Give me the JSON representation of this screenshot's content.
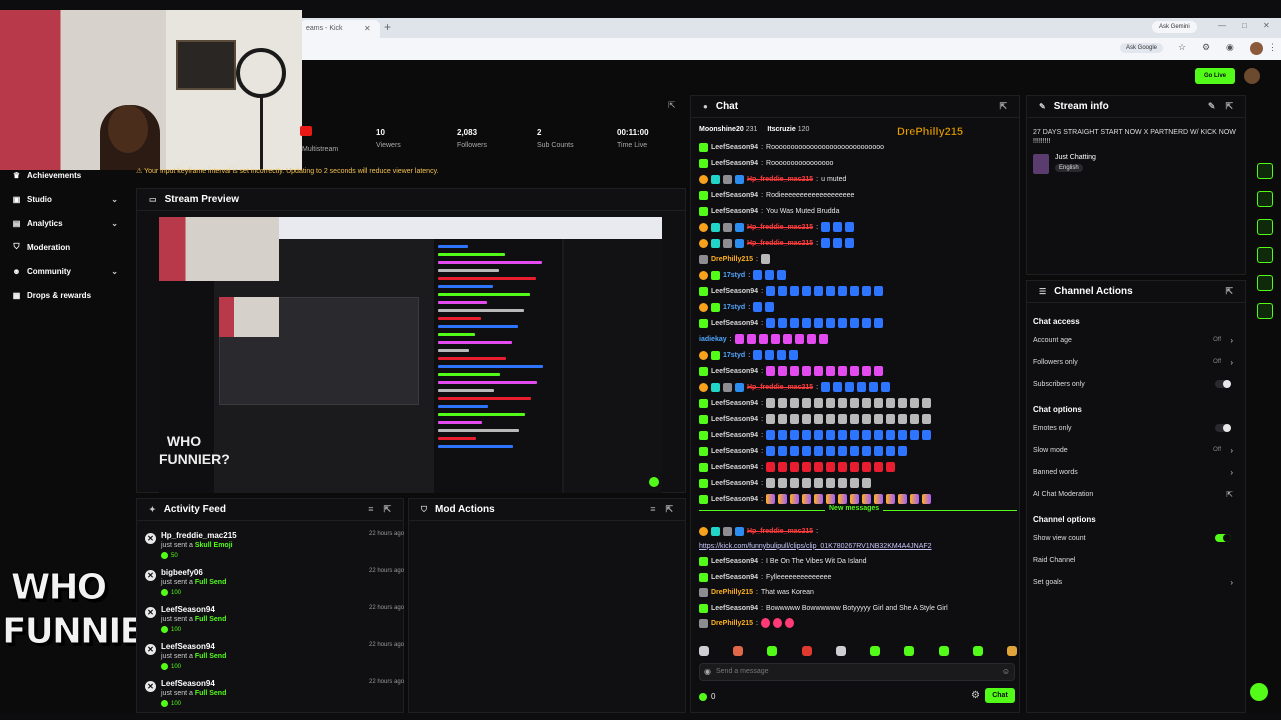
{
  "browser": {
    "tab_title": "eams - Kick",
    "ask_gemini": "Ask Gemini",
    "ask_google": "Ask Google"
  },
  "app": {
    "go_live": "Go Live"
  },
  "nav": {
    "items": [
      {
        "label": "Achievements",
        "icon": "trophy-icon",
        "chevron": false
      },
      {
        "label": "Studio",
        "icon": "video-icon",
        "chevron": true
      },
      {
        "label": "Analytics",
        "icon": "chart-icon",
        "chevron": true
      },
      {
        "label": "Moderation",
        "icon": "shield-icon",
        "chevron": false
      },
      {
        "label": "Community",
        "icon": "users-icon",
        "chevron": true
      },
      {
        "label": "Drops & rewards",
        "icon": "gift-icon",
        "chevron": false
      }
    ]
  },
  "logo_text": "WHO FUNNIER?",
  "stats": {
    "multistream_label": "Multistream",
    "viewers": {
      "value": "10",
      "label": "Viewers"
    },
    "followers": {
      "value": "2,083",
      "label": "Followers"
    },
    "subs": {
      "value": "2",
      "label": "Sub Counts"
    },
    "time": {
      "value": "00:11:00",
      "label": "Time Live"
    }
  },
  "alert_text": "Your input keyframe interval is set incorrectly. Updating to 2 seconds will reduce viewer latency.",
  "preview": {
    "title": "Stream Preview",
    "overlay_text": "WHO FUNNIER?"
  },
  "activity": {
    "title": "Activity Feed",
    "items": [
      {
        "name": "Hp_freddie_mac215",
        "action": "just sent a ",
        "item": "Skull Emoji",
        "time": "22 hours ago",
        "amount": "50"
      },
      {
        "name": "bigbeefy06",
        "action": "just sent a ",
        "item": "Full Send",
        "time": "22 hours ago",
        "amount": "100"
      },
      {
        "name": "LeefSeason94",
        "action": "just sent a ",
        "item": "Full Send",
        "time": "22 hours ago",
        "amount": "100"
      },
      {
        "name": "LeefSeason94",
        "action": "just sent a ",
        "item": "Full Send",
        "time": "22 hours ago",
        "amount": "100"
      },
      {
        "name": "LeefSeason94",
        "action": "just sent a ",
        "item": "Full Send",
        "time": "22 hours ago",
        "amount": "100"
      }
    ]
  },
  "mod_actions": {
    "title": "Mod Actions"
  },
  "chat": {
    "title": "Chat",
    "pinned": [
      {
        "name": "Moonshine20",
        "value": "231"
      },
      {
        "name": "Itscruzie",
        "value": "120"
      }
    ],
    "overlay_name": "DrePhilly215",
    "new_messages_label": "New messages",
    "input_placeholder": "Send a message",
    "viewer_count": "0",
    "send_label": "Chat",
    "messages": [
      {
        "user": "LeefSeason94",
        "ucls": "u-green",
        "badges": [
          "b-green"
        ],
        "text": "Rooooooooooooooooooooooooooooo"
      },
      {
        "user": "LeefSeason94",
        "ucls": "u-green",
        "badges": [
          "b-green"
        ],
        "text": "Roooooooooooooooo"
      },
      {
        "user": "Hp_freddie_mac215",
        "ucls": "u-red",
        "badges": [
          "b-orange",
          "b-teal",
          "b-gray",
          "b-blue"
        ],
        "text": "u muted"
      },
      {
        "user": "LeefSeason94",
        "ucls": "u-green",
        "badges": [
          "b-green"
        ],
        "text": "Rodieeeeeeeeeeeeeeeeeee"
      },
      {
        "user": "LeefSeason94",
        "ucls": "u-green",
        "badges": [
          "b-green"
        ],
        "text": "You Was Muted Brudda"
      },
      {
        "user": "Hp_freddie_mac215",
        "ucls": "u-red",
        "badges": [
          "b-orange",
          "b-teal",
          "b-gray",
          "b-blue"
        ],
        "text": "",
        "emotes": 3,
        "ecls": "e-blue"
      },
      {
        "user": "Hp_freddie_mac215",
        "ucls": "u-red",
        "badges": [
          "b-orange",
          "b-teal",
          "b-gray",
          "b-blue"
        ],
        "text": "",
        "emotes": 3,
        "ecls": "e-blue"
      },
      {
        "user": "DrePhilly215",
        "ucls": "u-orange",
        "badges": [
          "b-gray"
        ],
        "text": "",
        "emotes": 1,
        "ecls": "e-gray"
      },
      {
        "user": "17styd",
        "ucls": "u-cyan",
        "badges": [
          "b-orange",
          "b-green"
        ],
        "text": "",
        "emotes": 3,
        "ecls": "e-blue"
      },
      {
        "user": "LeefSeason94",
        "ucls": "u-green",
        "badges": [
          "b-green"
        ],
        "text": "",
        "emotes": 10,
        "ecls": "e-blue"
      },
      {
        "user": "17styd",
        "ucls": "u-cyan",
        "badges": [
          "b-orange",
          "b-green"
        ],
        "text": "",
        "emotes": 2,
        "ecls": "e-blue"
      },
      {
        "user": "LeefSeason94",
        "ucls": "u-green",
        "badges": [
          "b-green"
        ],
        "text": "",
        "emotes": 10,
        "ecls": "e-blue"
      },
      {
        "user": "iadiekay",
        "ucls": "u-cyan",
        "badges": [],
        "text": "",
        "emotes": 8,
        "ecls": "e-pink"
      },
      {
        "user": "17styd",
        "ucls": "u-cyan",
        "badges": [
          "b-orange",
          "b-green"
        ],
        "text": "",
        "emotes": 4,
        "ecls": "e-blue"
      },
      {
        "user": "LeefSeason94",
        "ucls": "u-green",
        "badges": [
          "b-green"
        ],
        "text": "",
        "emotes": 10,
        "ecls": "e-pink"
      },
      {
        "user": "Hp_freddie_mac215",
        "ucls": "u-red",
        "badges": [
          "b-orange",
          "b-teal",
          "b-gray",
          "b-blue"
        ],
        "text": "",
        "emotes": 6,
        "ecls": "e-blue"
      },
      {
        "user": "LeefSeason94",
        "ucls": "u-green",
        "badges": [
          "b-green"
        ],
        "text": "",
        "emotes": 14,
        "ecls": "e-gray"
      },
      {
        "user": "LeefSeason94",
        "ucls": "u-green",
        "badges": [
          "b-green"
        ],
        "text": "",
        "emotes": 14,
        "ecls": "e-gray"
      },
      {
        "user": "LeefSeason94",
        "ucls": "u-green",
        "badges": [
          "b-green"
        ],
        "text": "",
        "emotes": 14,
        "ecls": "e-blue"
      },
      {
        "user": "LeefSeason94",
        "ucls": "u-green",
        "badges": [
          "b-green"
        ],
        "text": "",
        "emotes": 12,
        "ecls": "e-blue"
      },
      {
        "user": "LeefSeason94",
        "ucls": "u-green",
        "badges": [
          "b-green"
        ],
        "text": "",
        "emotes": 11,
        "ecls": "e-red"
      },
      {
        "user": "LeefSeason94",
        "ucls": "u-green",
        "badges": [
          "b-green"
        ],
        "text": "",
        "emotes": 9,
        "ecls": "e-gray"
      },
      {
        "user": "LeefSeason94",
        "ucls": "u-green",
        "badges": [
          "b-green"
        ],
        "text": "",
        "emotes": 14,
        "ecls": "e-mix"
      },
      {
        "user": "Hp_freddie_mac215",
        "ucls": "u-red",
        "badges": [
          "b-orange",
          "b-teal",
          "b-gray",
          "b-blue"
        ],
        "text": ""
      },
      {
        "user": "",
        "ucls": "u-green",
        "badges": [],
        "text": "https://kick.com/funnybulipull/clips/clip_01K780267RV1NB32KM4A4JNAF2",
        "link": true
      },
      {
        "user": "LeefSeason94",
        "ucls": "u-green",
        "badges": [
          "b-green"
        ],
        "text": "I Be On The Vibes Wit Da Island"
      },
      {
        "user": "LeefSeason94",
        "ucls": "u-green",
        "badges": [
          "b-green"
        ],
        "text": "Fylleeeeeeeeeeeeee"
      },
      {
        "user": "DrePhilly215",
        "ucls": "u-orange",
        "badges": [
          "b-gray"
        ],
        "text": "That was Korean"
      },
      {
        "user": "LeefSeason94",
        "ucls": "u-green",
        "badges": [
          "b-green"
        ],
        "text": "Bowwwww Bowwwwww Botyyyyy Girl and She A Style Girl"
      },
      {
        "user": "DrePhilly215",
        "ucls": "u-orange",
        "badges": [
          "b-gray"
        ],
        "text": "",
        "emotes": 3,
        "ecls": "e-pinkred"
      }
    ]
  },
  "stream_info": {
    "title": "Stream info",
    "stream_title": "27 DAYS STRAIGHT START NOW X PARTNERD W/ KICK NOW !!!!!!!!!",
    "category": "Just Chatting",
    "language": "English"
  },
  "channel_actions": {
    "title": "Channel Actions",
    "sections": [
      {
        "label": "Chat access",
        "rows": [
          {
            "label": "Account age",
            "value": "Off",
            "type": "arrow"
          },
          {
            "label": "Followers only",
            "value": "Off",
            "type": "arrow"
          },
          {
            "label": "Subscribers only",
            "value": "",
            "type": "toggle-off"
          }
        ]
      },
      {
        "label": "Chat options",
        "rows": [
          {
            "label": "Emotes only",
            "value": "",
            "type": "toggle-off"
          },
          {
            "label": "Slow mode",
            "value": "Off",
            "type": "arrow"
          },
          {
            "label": "Banned words",
            "value": "",
            "type": "arrow"
          },
          {
            "label": "AI Chat Moderation",
            "value": "",
            "type": "external"
          }
        ]
      },
      {
        "label": "Channel options",
        "rows": [
          {
            "label": "Show view count",
            "value": "",
            "type": "toggle-on"
          },
          {
            "label": "Raid Channel",
            "value": "",
            "type": "none"
          },
          {
            "label": "Set goals",
            "value": "",
            "type": "arrow"
          }
        ]
      }
    ]
  },
  "colors": {
    "accent": "#53fc18",
    "bg": "#0b0b0c",
    "panel": "#101012",
    "live": "#e91916"
  }
}
